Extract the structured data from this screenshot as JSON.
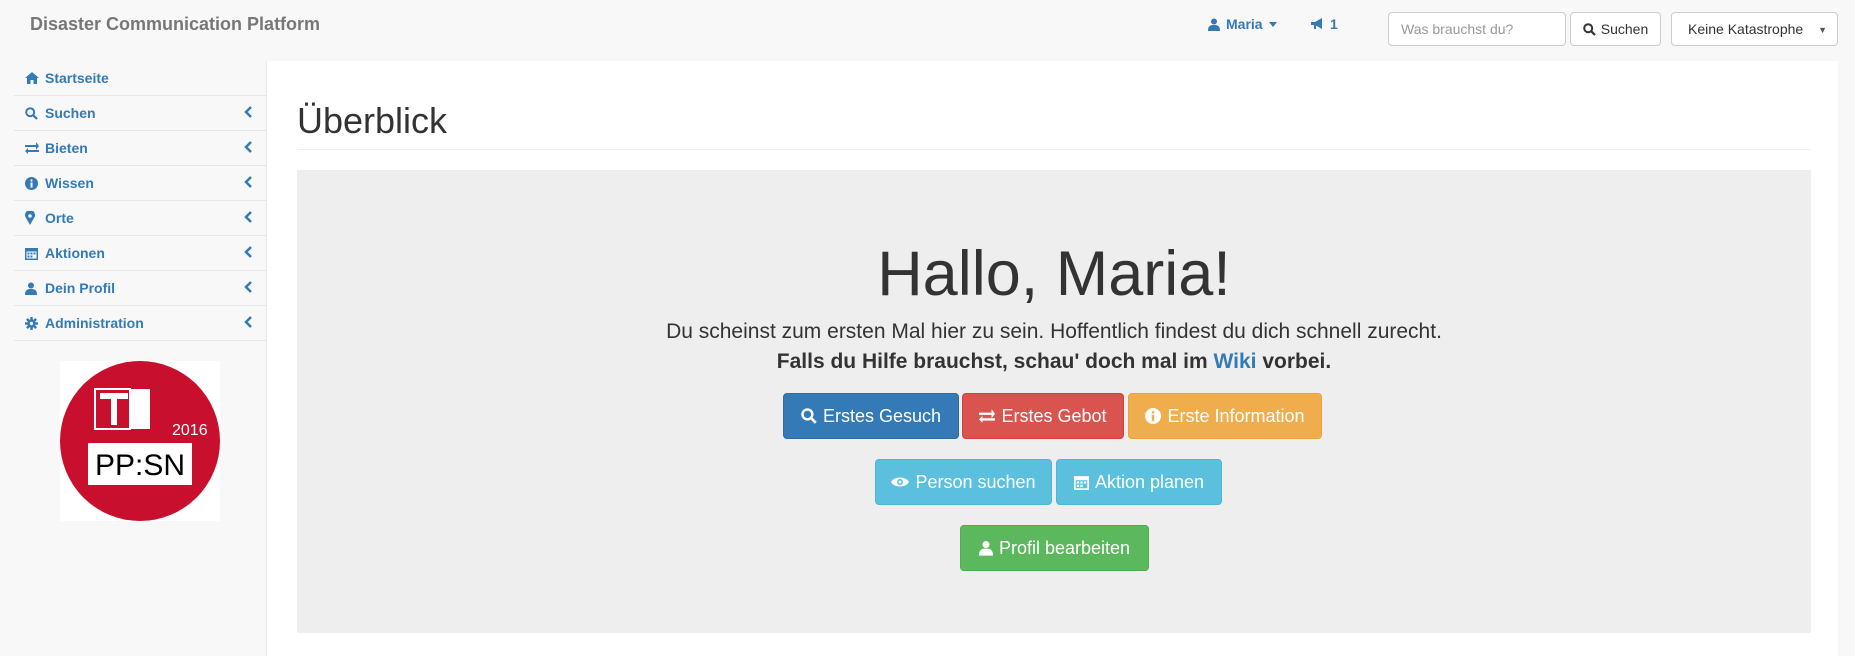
{
  "navbar": {
    "brand": "Disaster Communication Platform",
    "user_name": "Maria",
    "notification_count": "1",
    "search_placeholder": "Was brauchst du?",
    "search_button": "Suchen",
    "disaster_select": "Keine Katastrophe"
  },
  "sidebar": {
    "items": [
      {
        "label": "Startseite",
        "icon": "home-icon"
      },
      {
        "label": "Suchen",
        "icon": "search-icon"
      },
      {
        "label": "Bieten",
        "icon": "exchange-icon"
      },
      {
        "label": "Wissen",
        "icon": "info-icon"
      },
      {
        "label": "Orte",
        "icon": "map-marker-icon"
      },
      {
        "label": "Aktionen",
        "icon": "calendar-icon"
      },
      {
        "label": "Dein Profil",
        "icon": "user-icon"
      },
      {
        "label": "Administration",
        "icon": "gear-icon"
      }
    ],
    "logo": {
      "text": "PP:SN",
      "year": "2016"
    }
  },
  "main": {
    "page_title": "Überblick",
    "greeting": "Hallo, Maria!",
    "intro": "Du scheinst zum ersten Mal hier zu sein. Hoffentlich findest du dich schnell zurecht.",
    "help_prefix": "Falls du Hilfe brauchst, schau' doch mal im",
    "help_link": "Wiki",
    "help_suffix": "vorbei.",
    "buttons": {
      "first_request": "Erstes Gesuch",
      "first_offer": "Erstes Gebot",
      "first_info": "Erste Information",
      "find_person": "Person suchen",
      "plan_action": "Aktion planen",
      "edit_profile": "Profil bearbeiten"
    }
  },
  "colors": {
    "primary": "#337ab7",
    "danger": "#d9534f",
    "warning": "#f0ad4e",
    "info": "#5bc0de",
    "success": "#5cb85c",
    "logo_red": "#c8102e"
  }
}
